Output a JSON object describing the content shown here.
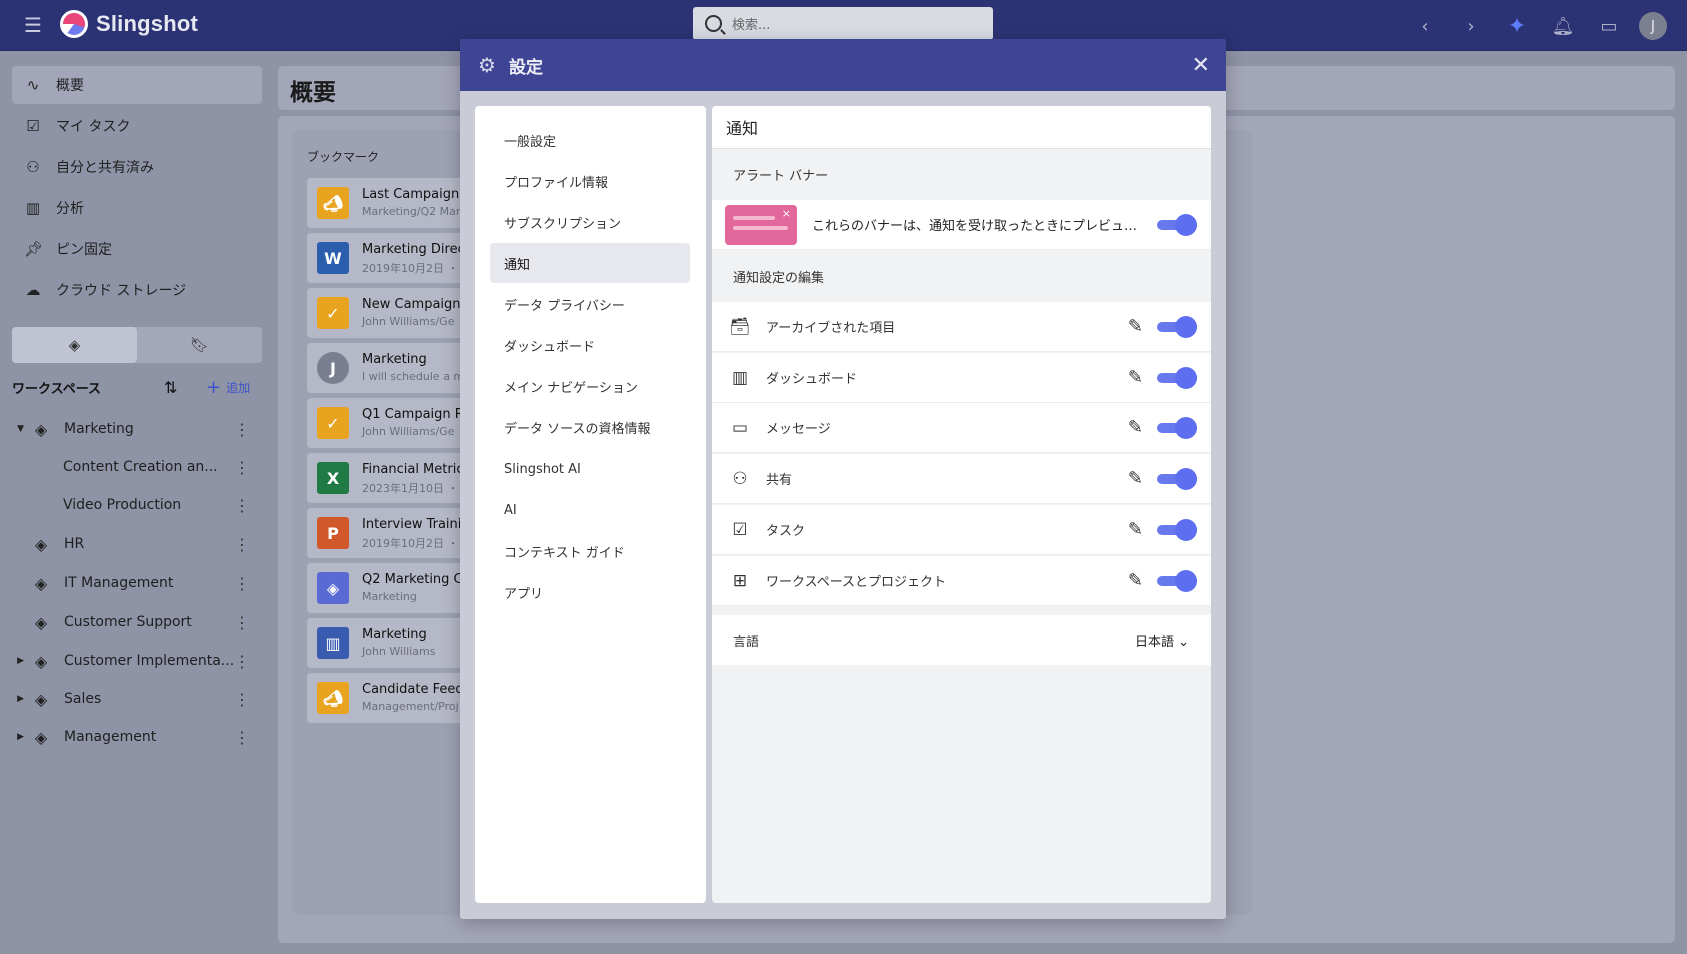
{
  "app": {
    "name": "Slingshot",
    "avatar_initial": "J"
  },
  "search": {
    "placeholder": "検索..."
  },
  "sidebar": {
    "nav": [
      {
        "label": "概要",
        "icon": "activity-icon"
      },
      {
        "label": "マイ タスク",
        "icon": "task-icon"
      },
      {
        "label": "自分と共有済み",
        "icon": "shared-user-icon"
      },
      {
        "label": "分析",
        "icon": "bar-chart-icon"
      },
      {
        "label": "ピン固定",
        "icon": "pin-icon"
      },
      {
        "label": "クラウド ストレージ",
        "icon": "cloud-icon"
      }
    ],
    "workspaces_title": "ワークスペース",
    "add_label": "追加",
    "workspaces": [
      {
        "label": "Marketing",
        "expanded": true
      },
      {
        "label": "Content Creation an...",
        "child": true
      },
      {
        "label": "Video Production",
        "child": true
      },
      {
        "label": "HR"
      },
      {
        "label": "IT Management"
      },
      {
        "label": "Customer Support"
      },
      {
        "label": "Customer Implementa..."
      },
      {
        "label": "Sales"
      },
      {
        "label": "Management"
      }
    ]
  },
  "main": {
    "title": "概要",
    "bookmarks_title": "ブックマーク",
    "bookmarks": [
      {
        "name": "Last Campaign",
        "sub": "Marketing/Q2 Mar",
        "icon": "megaphone-icon",
        "color": "#e8a41f"
      },
      {
        "name": "Marketing Direc",
        "sub": "2019年10月2日 ・",
        "icon": "word-icon",
        "color": "#2b5fae"
      },
      {
        "name": "New Campaign",
        "sub": "John Williams/Ge",
        "icon": "clipboard-check-icon",
        "color": "#e8a41f"
      },
      {
        "name": "Marketing",
        "sub": "I will schedule a m",
        "icon": "user-avatar-icon",
        "color": "#7a7f90"
      },
      {
        "name": "Q1 Campaign R",
        "sub": "John Williams/Ge",
        "icon": "clipboard-check-icon",
        "color": "#e8a41f"
      },
      {
        "name": "Financial Metric",
        "sub": "2023年1月10日 ・",
        "icon": "excel-icon",
        "color": "#1f7a44"
      },
      {
        "name": "Interview Traini",
        "sub": "2019年10月2日 ・",
        "icon": "powerpoint-icon",
        "color": "#d0582a"
      },
      {
        "name": "Q2 Marketing C",
        "sub": "Marketing",
        "icon": "layers-icon",
        "color": "#5a6ad4"
      },
      {
        "name": "Marketing",
        "sub": "John Williams",
        "icon": "dashboard-chart-icon",
        "color": "#3a5cb0"
      },
      {
        "name": "Candidate Feed",
        "sub": "Management/Proj",
        "icon": "megaphone-icon",
        "color": "#e8a41f"
      }
    ]
  },
  "settings": {
    "title": "設定",
    "nav": [
      "一般設定",
      "プロファイル情報",
      "サブスクリプション",
      "通知",
      "データ プライバシー",
      "ダッシュボード",
      "メイン ナビゲーション",
      "データ ソースの資格情報",
      "Slingshot AI",
      "AI",
      "コンテキスト ガイド",
      "アプリ"
    ],
    "active_nav": "通知",
    "content_title": "通知",
    "alert_section": "アラート バナー",
    "banner_text": "これらのバナーは、通知を受け取ったときにプレビューを提供し...",
    "edit_section": "通知設定の編集",
    "rows": [
      {
        "label": "アーカイブされた項目",
        "icon": "archive-icon",
        "enabled": true
      },
      {
        "label": "ダッシュボード",
        "icon": "dashboard-icon",
        "enabled": true
      },
      {
        "label": "メッセージ",
        "icon": "message-icon",
        "enabled": true
      },
      {
        "label": "共有",
        "icon": "share-user-icon",
        "enabled": true
      },
      {
        "label": "タスク",
        "icon": "task-icon",
        "enabled": true
      },
      {
        "label": "ワークスペースとプロジェクト",
        "icon": "workspace-layout-icon",
        "enabled": true
      }
    ],
    "language_label": "言語",
    "language_value": "日本語"
  },
  "colors": {
    "topbar": "#2b3374",
    "modal_header": "#3e4594",
    "toggle": "#5d6ff0",
    "accent": "#3c53c9"
  }
}
